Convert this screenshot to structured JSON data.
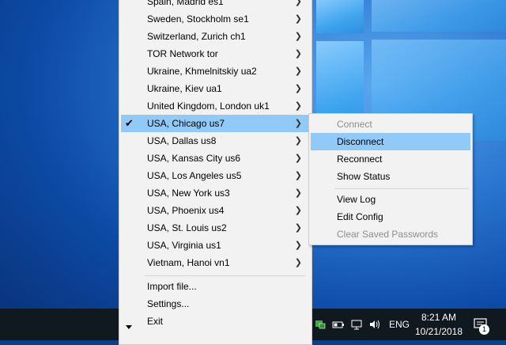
{
  "main_menu": {
    "servers": [
      {
        "label": "Spain, Madrid es1"
      },
      {
        "label": "Sweden, Stockholm se1"
      },
      {
        "label": "Switzerland, Zurich ch1"
      },
      {
        "label": "TOR Network tor"
      },
      {
        "label": "Ukraine, Khmelnitskiy ua2"
      },
      {
        "label": "Ukraine, Kiev ua1"
      },
      {
        "label": "United Kingdom, London uk1"
      },
      {
        "label": "USA, Chicago us7"
      },
      {
        "label": "USA, Dallas us8"
      },
      {
        "label": "USA, Kansas City us6"
      },
      {
        "label": "USA, Los Angeles us5"
      },
      {
        "label": "USA, New York us3"
      },
      {
        "label": "USA, Phoenix us4"
      },
      {
        "label": "USA, St. Louis us2"
      },
      {
        "label": "USA, Virginia us1"
      },
      {
        "label": "Vietnam, Hanoi vn1"
      }
    ],
    "actions": [
      {
        "label": "Import file..."
      },
      {
        "label": "Settings..."
      },
      {
        "label": "Exit"
      }
    ]
  },
  "submenu": {
    "items": [
      {
        "label": "Connect",
        "enabled": false
      },
      {
        "label": "Disconnect",
        "enabled": true
      },
      {
        "label": "Reconnect",
        "enabled": true
      },
      {
        "label": "Show Status",
        "enabled": true
      },
      {
        "label": "View Log",
        "enabled": true
      },
      {
        "label": "Edit Config",
        "enabled": true
      },
      {
        "label": "Clear Saved Passwords",
        "enabled": false
      }
    ]
  },
  "taskbar": {
    "language": "ENG",
    "time": "8:21 AM",
    "date": "10/21/2018",
    "notification_count": "1"
  },
  "colors": {
    "menu_bg": "#f2f2f2",
    "highlight": "#91c9f7",
    "taskbar": "#101820"
  }
}
